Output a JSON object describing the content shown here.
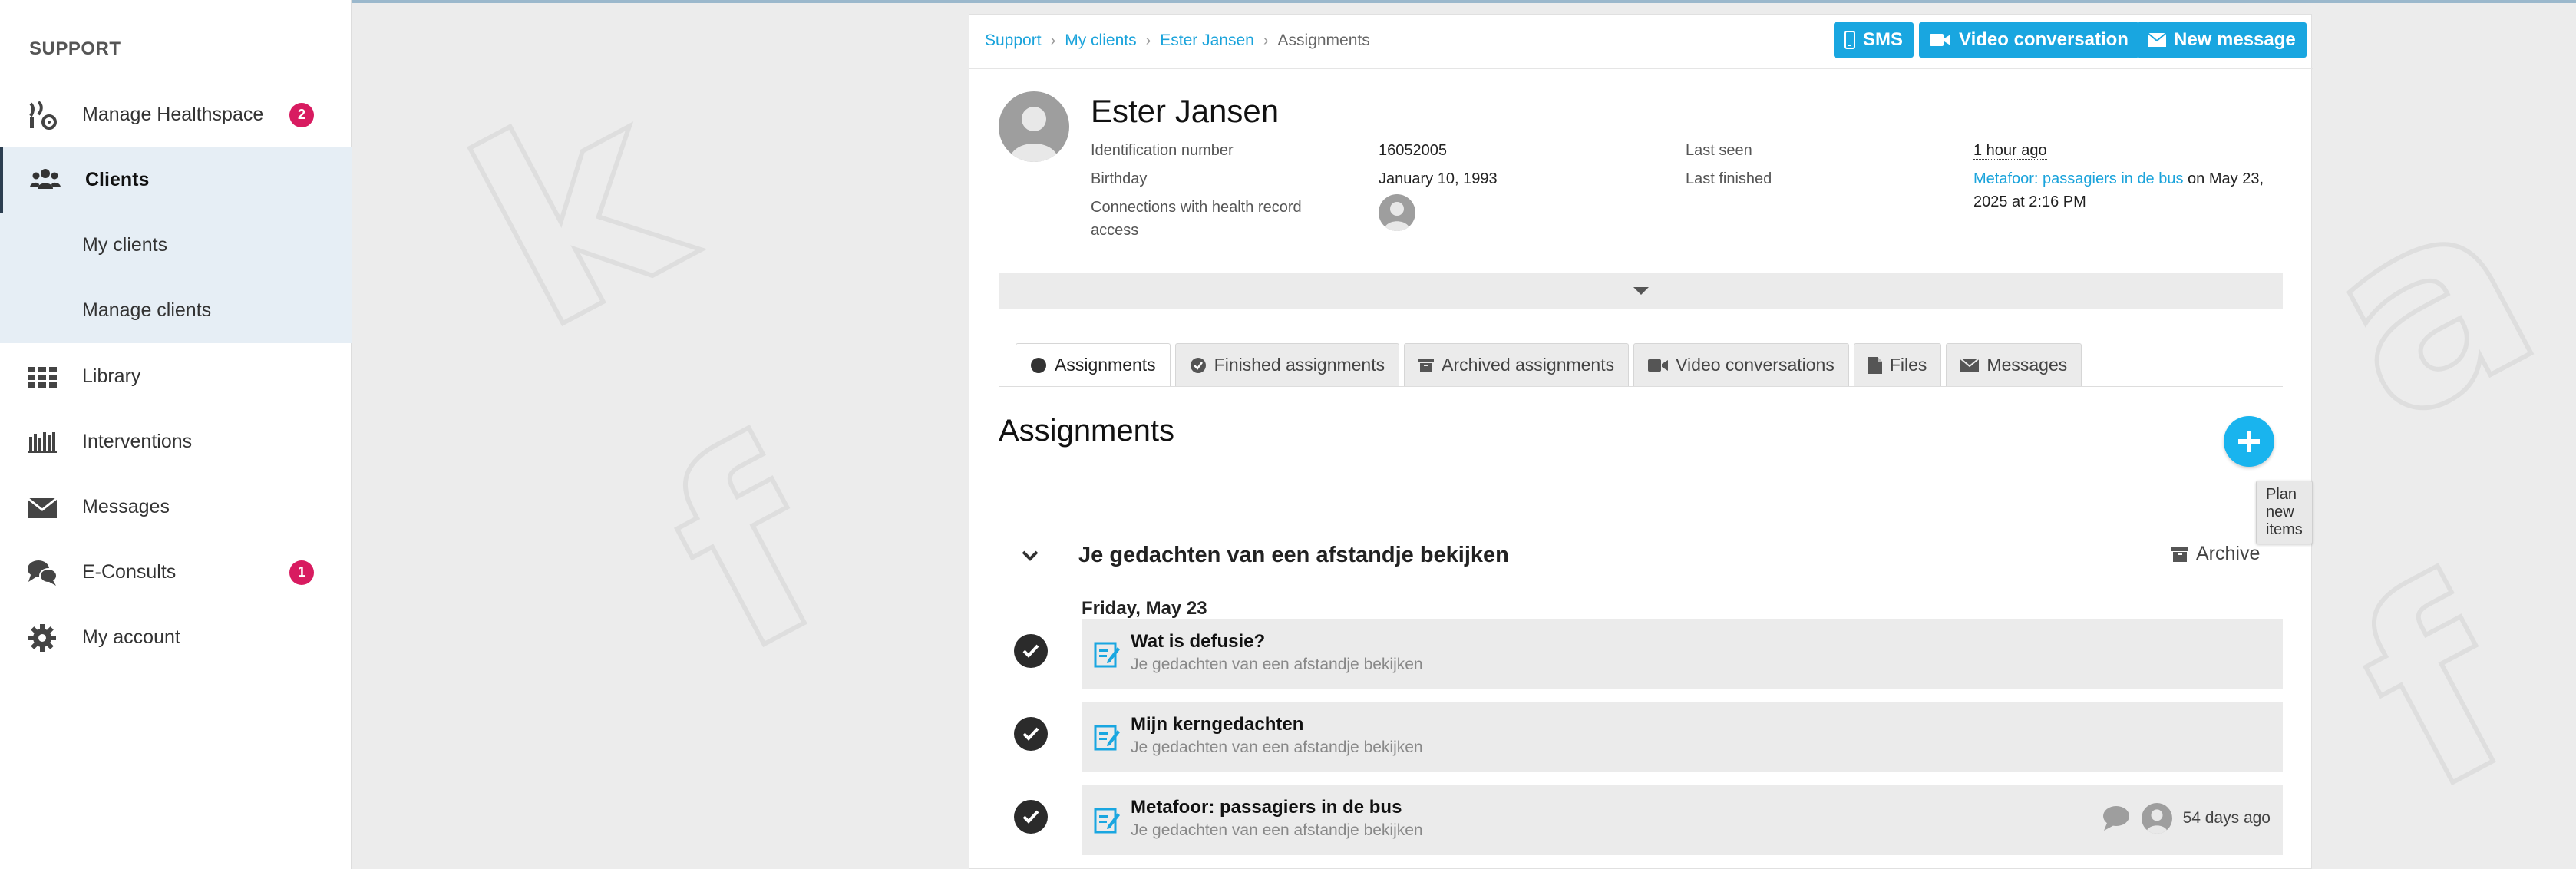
{
  "sidebar": {
    "heading": "SUPPORT",
    "items": [
      {
        "label": "Manage Healthspace",
        "icon": "plant-gear-icon",
        "badge": "2"
      },
      {
        "label": "Clients",
        "icon": "users-icon"
      },
      {
        "label": "My clients"
      },
      {
        "label": "Manage clients"
      },
      {
        "label": "Library",
        "icon": "grid-icon"
      },
      {
        "label": "Interventions",
        "icon": "bookshelf-icon"
      },
      {
        "label": "Messages",
        "icon": "envelope-icon"
      },
      {
        "label": "E-Consults",
        "icon": "chat-bubbles-icon",
        "badge": "1"
      },
      {
        "label": "My account",
        "icon": "gear-icon"
      }
    ]
  },
  "breadcrumb": [
    "Support",
    "My clients",
    "Ester Jansen",
    "Assignments"
  ],
  "header_buttons": {
    "sms": "SMS",
    "video": "Video conversation",
    "message": "New message"
  },
  "client": {
    "name": "Ester Jansen",
    "id_label": "Identification number",
    "id_value": "16052005",
    "birthday_label": "Birthday",
    "birthday_value": "January 10, 1993",
    "connections_label": "Connections with health record access",
    "last_seen_label": "Last seen",
    "last_seen_value": "1 hour ago",
    "last_finished_label": "Last finished",
    "last_finished_link": "Metafoor: passagiers in de bus",
    "last_finished_rest": " on May 23, 2025 at 2:16 PM"
  },
  "tabs": [
    {
      "label": "Assignments",
      "icon": "circle-icon",
      "active": true
    },
    {
      "label": "Finished assignments",
      "icon": "check-circle-icon"
    },
    {
      "label": "Archived assignments",
      "icon": "archive-icon"
    },
    {
      "label": "Video conversations",
      "icon": "video-icon"
    },
    {
      "label": "Files",
      "icon": "file-icon"
    },
    {
      "label": "Messages",
      "icon": "envelope-icon"
    }
  ],
  "section_title": "Assignments",
  "fab_tooltip": "Plan new items",
  "group": {
    "title": "Je gedachten van een afstandje bekijken",
    "archive_label": "Archive",
    "date": "Friday, May 23",
    "assignments": [
      {
        "title": "Wat is defusie?",
        "subtitle": "Je gedachten van een afstandje bekijken",
        "status": "done"
      },
      {
        "title": "Mijn kerngedachten",
        "subtitle": "Je gedachten van een afstandje bekijken",
        "status": "done"
      },
      {
        "title": "Metafoor: passagiers in de bus",
        "subtitle": "Je gedachten van een afstandje bekijken",
        "status": "done",
        "meta": "54 days ago"
      }
    ]
  },
  "colors": {
    "accent": "#19a6e0",
    "badge": "#d81b60",
    "sidebar_active": "#e6eef5"
  }
}
